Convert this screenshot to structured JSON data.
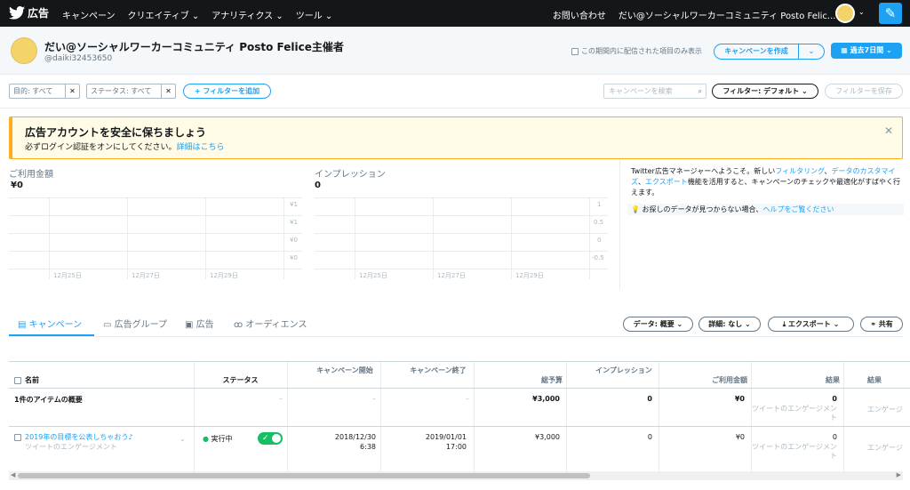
{
  "nav": {
    "brand": "広告",
    "menu": [
      "キャンペーン",
      "クリエイティブ ⌄",
      "アナリティクス ⌄",
      "ツール ⌄"
    ],
    "contact": "お問い合わせ",
    "account": "だい@ソーシャルワーカーコミュニティ Posto Felic... ⌄",
    "compose_icon": "compose-icon"
  },
  "account": {
    "name": "だい@ソーシャルワーカーコミュニティ Posto Felice主催者",
    "handle": "@daiki32453650",
    "checkbox_label": "この期間内に配信された項目のみ表示",
    "create_label": "キャンペーンを作成",
    "period_label": "過去7日間 ⌄"
  },
  "filters": {
    "objective": "目的: すべて",
    "status": "ステータス: すべて",
    "add": "+ フィルターを追加",
    "search_placeholder": "キャンペーンを検索",
    "filter_default": "フィルター: デフォルト ⌄",
    "filter_save": "フィルターを保存"
  },
  "alert": {
    "title": "広告アカウントを安全に保ちましょう",
    "desc": "必ずログイン認証をオンにしてください。",
    "link": "詳細はこちら"
  },
  "metrics": {
    "spend_label": "ご利用金額",
    "spend_value": "¥0",
    "impressions_label": "インプレッション",
    "impressions_value": "0"
  },
  "chart_data": [
    {
      "type": "line",
      "title": "ご利用金額",
      "x_ticks": [
        "12月25日",
        "12月27日",
        "12月29日"
      ],
      "y_ticks": [
        "¥1",
        "¥1",
        "¥0",
        "¥0"
      ],
      "series": [],
      "grid": true
    },
    {
      "type": "line",
      "title": "インプレッション",
      "x_ticks": [
        "12月25日",
        "12月27日",
        "12月29日"
      ],
      "y_ticks": [
        "1",
        "0.5",
        "0",
        "-0.5"
      ],
      "series": [],
      "grid": true
    }
  ],
  "side": {
    "intro1": "Twitter広告マネージャーへようこそ。新しい",
    "link1": "フィルタリング",
    "sep1": "、",
    "link2": "データのカスタマイズ",
    "sep2": "、",
    "link3": "エクスポート",
    "intro2": "機能を活用すると、キャンペーンのチェックや最適化がすばやく行えます。",
    "help_text": "お探しのデータが見つからない場合、",
    "help_link": "ヘルプをご覧ください"
  },
  "tabs": [
    "キャンペーン",
    "広告グループ",
    "広告",
    "オーディエンス"
  ],
  "table_controls": {
    "data": "データ: 概要 ⌄",
    "detail": "詳細: なし ⌄",
    "export": "エクスポート ⌄",
    "share": "共有"
  },
  "table": {
    "headers": {
      "name": "名前",
      "status": "ステータス",
      "start": "キャンペーン開始",
      "end": "キャンペーン終了",
      "budget": "総予算",
      "impressions": "インプレッション",
      "spend": "ご利用金額",
      "results": "結果",
      "results2": "結果"
    },
    "summary": {
      "name": "1件のアイテムの概要",
      "status": "–",
      "start": "–",
      "end": "–",
      "budget": "¥3,000",
      "impressions": "0",
      "spend": "¥0",
      "results": "0",
      "results_sub": "ツイートのエンゲージメント",
      "results2_sub": "エンゲージ"
    },
    "row": {
      "name": "2019年の目標を公表しちゃおう♪",
      "objective": "ツイートのエンゲージメント",
      "status": "実行中",
      "start_date": "2018/12/30",
      "start_time": "6:38",
      "end_date": "2019/01/01",
      "end_time": "17:00",
      "budget": "¥3,000",
      "impressions": "0",
      "spend": "¥0",
      "results": "0",
      "results_sub": "ツイートのエンゲージメント",
      "results2_sub": "エンゲージ"
    }
  }
}
